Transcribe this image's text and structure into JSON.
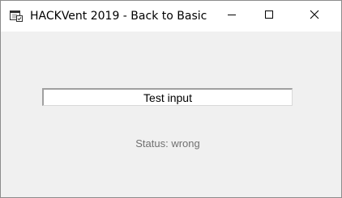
{
  "window": {
    "title": "HACKVent 2019 - Back to Basic",
    "icon": "app-window-icon"
  },
  "caption_buttons": {
    "minimize_icon": "minimize-icon",
    "maximize_icon": "maximize-icon",
    "close_icon": "close-icon"
  },
  "form": {
    "input_value": "Test input",
    "status_text": "Status: wrong"
  },
  "colors": {
    "window_background": "#f0f0f0",
    "titlebar_background": "#ffffff",
    "status_text": "#707070"
  }
}
